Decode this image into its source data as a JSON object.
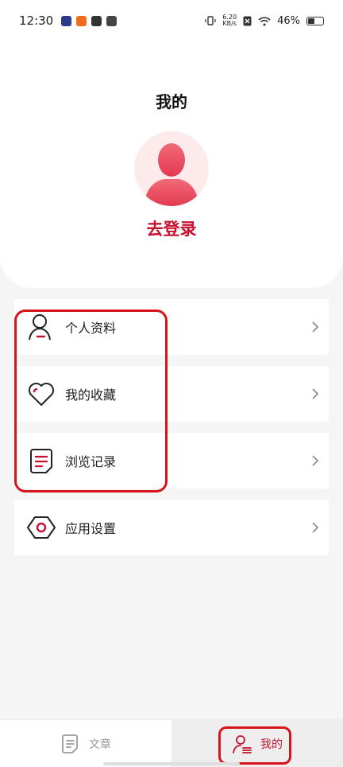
{
  "status_bar": {
    "time": "12:30",
    "net_speed_value": "6.20",
    "net_speed_unit": "KB/s",
    "battery": "46%",
    "battery_level": 0.46
  },
  "header": {
    "title": "我的",
    "login_label": "去登录"
  },
  "menu": {
    "items": [
      {
        "label": "个人资料",
        "icon": "person-icon"
      },
      {
        "label": "我的收藏",
        "icon": "heart-icon"
      },
      {
        "label": "浏览记录",
        "icon": "document-list-icon"
      },
      {
        "label": "应用设置",
        "icon": "settings-hexagon-icon"
      }
    ]
  },
  "bottom_nav": {
    "tabs": [
      {
        "label": "文章",
        "icon": "article-icon",
        "active": false
      },
      {
        "label": "我的",
        "icon": "profile-icon",
        "active": true
      }
    ]
  },
  "colors": {
    "accent": "#c8102e",
    "annotation": "#d7141a",
    "background": "#f5f5f5"
  }
}
